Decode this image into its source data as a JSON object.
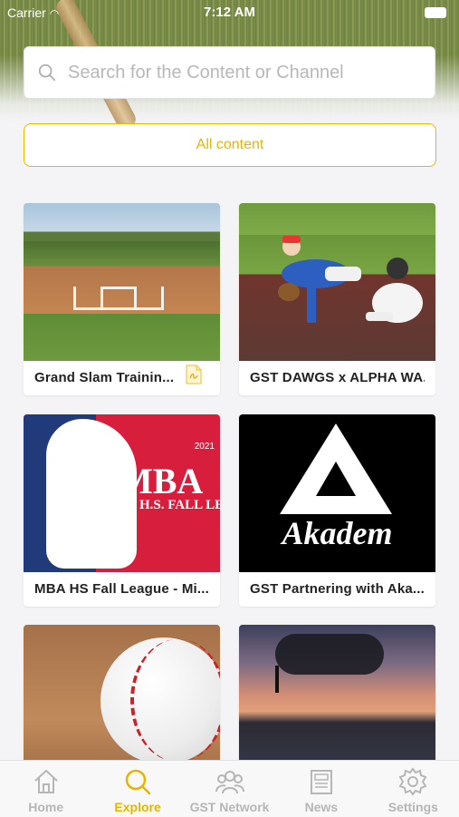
{
  "status_bar": {
    "carrier": "Carrier",
    "time": "7:12 AM"
  },
  "search": {
    "placeholder": "Search for the Content or Channel",
    "value": ""
  },
  "filter": {
    "label": "All content"
  },
  "cards": [
    {
      "title": "Grand Slam Trainin...",
      "has_pdf_icon": true
    },
    {
      "title": "GST DAWGS x ALPHA WA..."
    },
    {
      "title": "MBA HS Fall League - Mi..."
    },
    {
      "title": "GST Partnering with Aka..."
    },
    {
      "title": ""
    },
    {
      "title": ""
    }
  ],
  "thumb_text": {
    "mba_big": "MBA",
    "mba_sub": "H.S. FALL LEAGU",
    "mba_year": "2021",
    "akademy_word": "Akadem"
  },
  "tabs": [
    {
      "label": "Home",
      "icon": "home-icon"
    },
    {
      "label": "Explore",
      "icon": "search-icon",
      "active": true
    },
    {
      "label": "GST Network",
      "icon": "network-icon"
    },
    {
      "label": "News",
      "icon": "news-icon"
    },
    {
      "label": "Settings",
      "icon": "gear-icon"
    }
  ],
  "colors": {
    "accent": "#e8b400",
    "inactive": "#b6b6b6"
  }
}
